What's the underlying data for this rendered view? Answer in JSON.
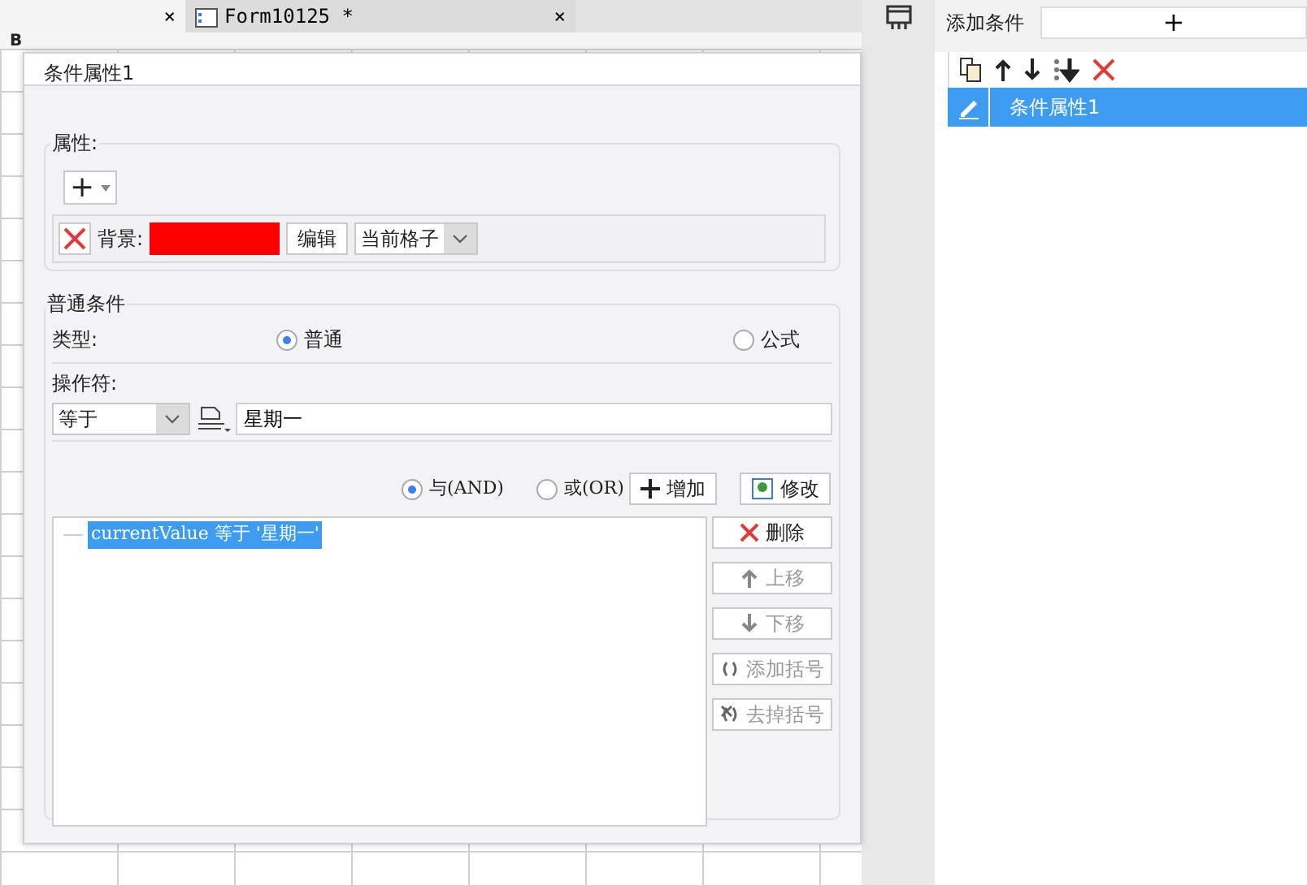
{
  "editor": {
    "tabs": [
      {
        "close": "×",
        "selected": true
      },
      {
        "label": "Form10125 *",
        "close": "×",
        "selected": false
      }
    ],
    "toolbar_text": "B"
  },
  "dialog": {
    "title": "条件属性1",
    "attributes": {
      "legend": "属性:",
      "add_button": "+",
      "items": [
        {
          "label": "背景:",
          "color": "#ff0000",
          "edit": "编辑",
          "scope": "当前格子"
        }
      ]
    },
    "general": {
      "legend": "普通条件",
      "type_label": "类型:",
      "type_options": [
        {
          "label": "普通",
          "selected": true
        },
        {
          "label": "公式",
          "selected": false
        }
      ],
      "operator_label": "操作符:",
      "operator": "等于",
      "value": "星期一",
      "joins": [
        {
          "label": "与(AND)",
          "selected": true
        },
        {
          "label": "或(OR)",
          "selected": false
        }
      ],
      "add": "增加",
      "modify": "修改",
      "conditions": [
        {
          "text": "currentValue 等于 '星期一'",
          "selected": true
        }
      ],
      "actions": [
        {
          "label": "删除",
          "kind": "delete",
          "disabled": false
        },
        {
          "label": "上移",
          "kind": "up",
          "disabled": true
        },
        {
          "label": "下移",
          "kind": "down",
          "disabled": true
        },
        {
          "label": "添加括号",
          "kind": "addparen",
          "disabled": true
        },
        {
          "label": "去掉括号",
          "kind": "removeparen",
          "disabled": true
        }
      ]
    }
  },
  "side_panel": {
    "add_label": "添加条件",
    "add_button": "+",
    "conditions": [
      {
        "label": "条件属性1",
        "selected": true
      }
    ]
  }
}
